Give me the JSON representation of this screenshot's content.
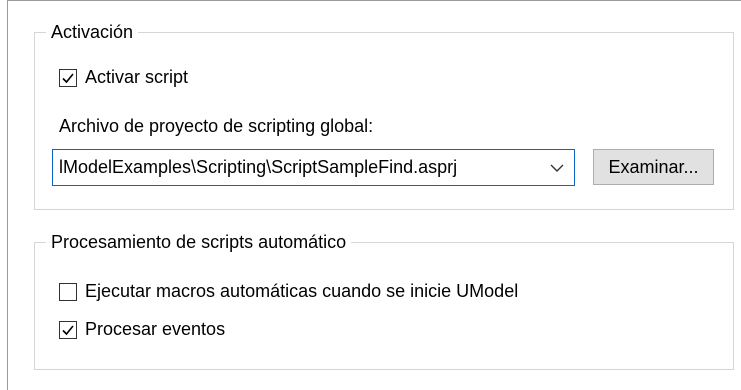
{
  "activation": {
    "group_title": "Activación",
    "enable_script": {
      "label": "Activar script",
      "checked": true
    },
    "project_label": "Archivo de proyecto de scripting global:",
    "project_value": "lModelExamples\\Scripting\\ScriptSampleFind.asprj",
    "browse_button": "Examinar..."
  },
  "auto_processing": {
    "group_title": "Procesamiento de scripts automático",
    "run_macros": {
      "label": "Ejecutar macros automáticas cuando se inicie UModel",
      "checked": false
    },
    "process_events": {
      "label": "Procesar eventos",
      "checked": true
    }
  },
  "icons": {
    "checkmark": "checkmark-icon",
    "dropdown": "chevron-down-icon"
  },
  "colors": {
    "combo_focus_border": "#0a64c8",
    "button_face": "#e1e1e1",
    "group_border": "#d6d6d6"
  }
}
